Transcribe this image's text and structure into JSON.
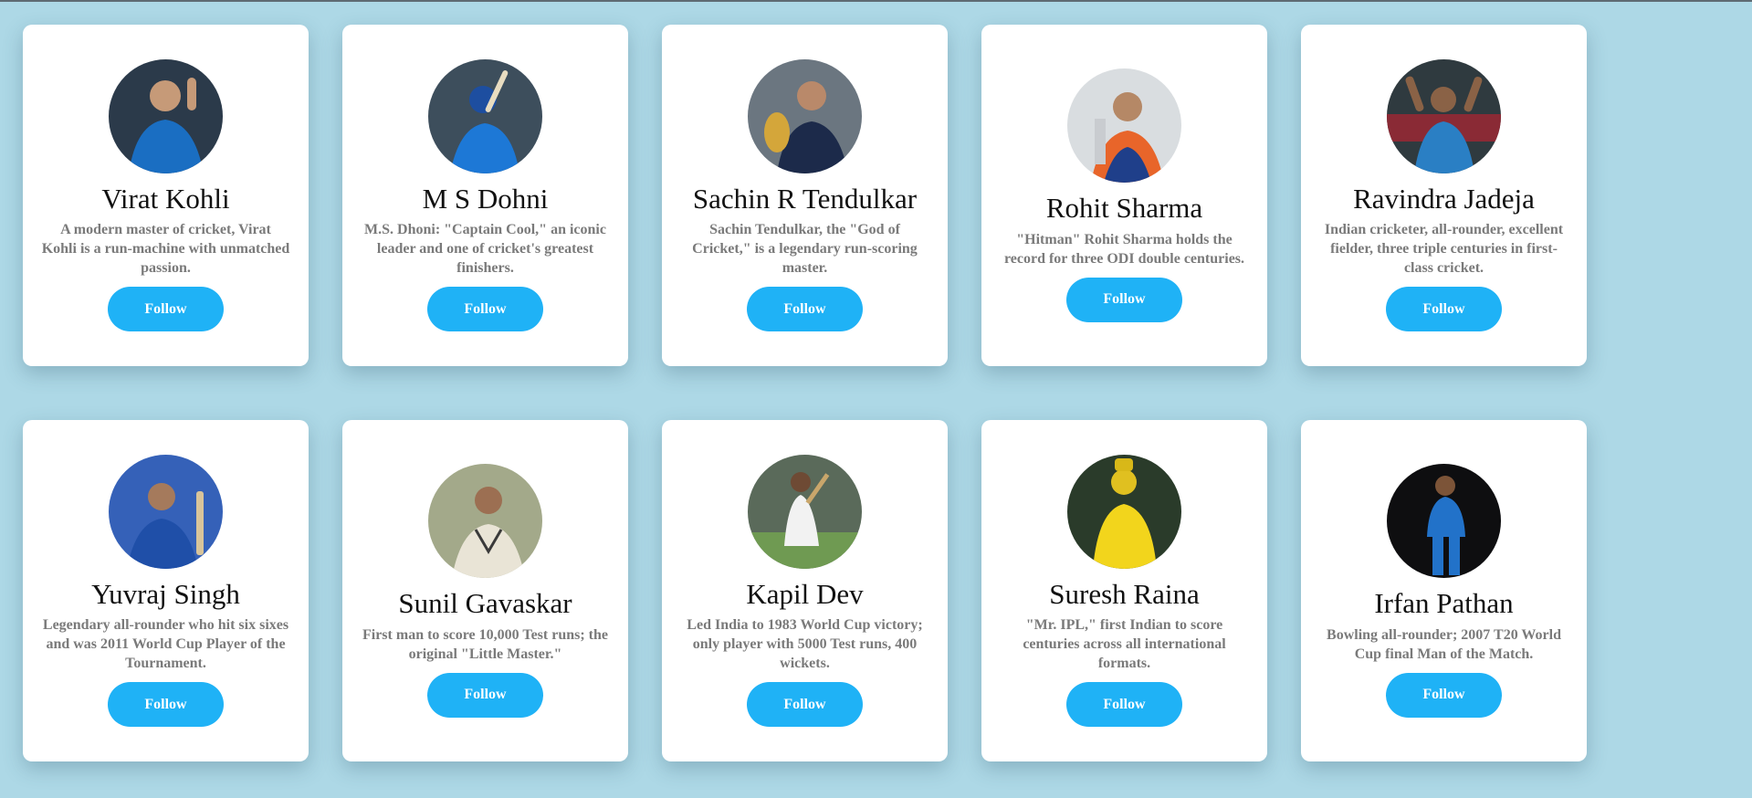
{
  "theme": {
    "background": "#add8e6",
    "card": "#ffffff",
    "button": "#1fb2f6",
    "name_color": "#111111",
    "bio_color": "#7a7a7a"
  },
  "players": [
    {
      "name": "Virat Kohli",
      "bio": "A modern master of cricket, Virat Kohli is a run-machine with unmatched passion.",
      "button_label": "Follow",
      "avatar_icon": "player-photo-icon",
      "jersey_color": "#1a6ec2"
    },
    {
      "name": "M S Dohni",
      "bio": "M.S. Dhoni: \"Captain Cool,\" an iconic leader and one of cricket's greatest finishers.",
      "button_label": "Follow",
      "avatar_icon": "player-photo-icon",
      "jersey_color": "#1d78d6"
    },
    {
      "name": "Sachin R Tendulkar",
      "bio": "Sachin Tendulkar, the \"God of Cricket,\" is a legendary run-scoring master.",
      "button_label": "Follow",
      "avatar_icon": "player-photo-icon",
      "jersey_color": "#1c2a4a"
    },
    {
      "name": "Rohit Sharma",
      "bio": "\"Hitman\" Rohit Sharma holds the record for three ODI double centuries.",
      "button_label": "Follow",
      "avatar_icon": "player-photo-icon",
      "jersey_color": "#e8652a"
    },
    {
      "name": "Ravindra Jadeja",
      "bio": "Indian cricketer, all-rounder, excellent fielder, three triple centuries in first-class cricket.",
      "button_label": "Follow",
      "avatar_icon": "player-photo-icon",
      "jersey_color": "#2a7fc4"
    },
    {
      "name": "Yuvraj Singh",
      "bio": "Legendary all-rounder who hit six sixes and was 2011 World Cup Player of the Tournament.",
      "button_label": "Follow",
      "avatar_icon": "player-photo-icon",
      "jersey_color": "#1f4fa8"
    },
    {
      "name": "Sunil Gavaskar",
      "bio": "First man to score 10,000 Test runs; the original \"Little Master.\"",
      "button_label": "Follow",
      "avatar_icon": "player-photo-icon",
      "jersey_color": "#e9e4d6"
    },
    {
      "name": "Kapil Dev",
      "bio": "Led India to 1983 World Cup victory; only player with 5000 Test runs, 400 wickets.",
      "button_label": "Follow",
      "avatar_icon": "player-photo-icon",
      "jersey_color": "#f2f2f2"
    },
    {
      "name": "Suresh Raina",
      "bio": "\"Mr. IPL,\" first Indian to score centuries across all international formats.",
      "button_label": "Follow",
      "avatar_icon": "player-photo-icon",
      "jersey_color": "#f2d51c"
    },
    {
      "name": "Irfan Pathan",
      "bio": "Bowling all-rounder; 2007 T20 World Cup final Man of the Match.",
      "button_label": "Follow",
      "avatar_icon": "player-photo-icon",
      "jersey_color": "#2272c9"
    }
  ]
}
